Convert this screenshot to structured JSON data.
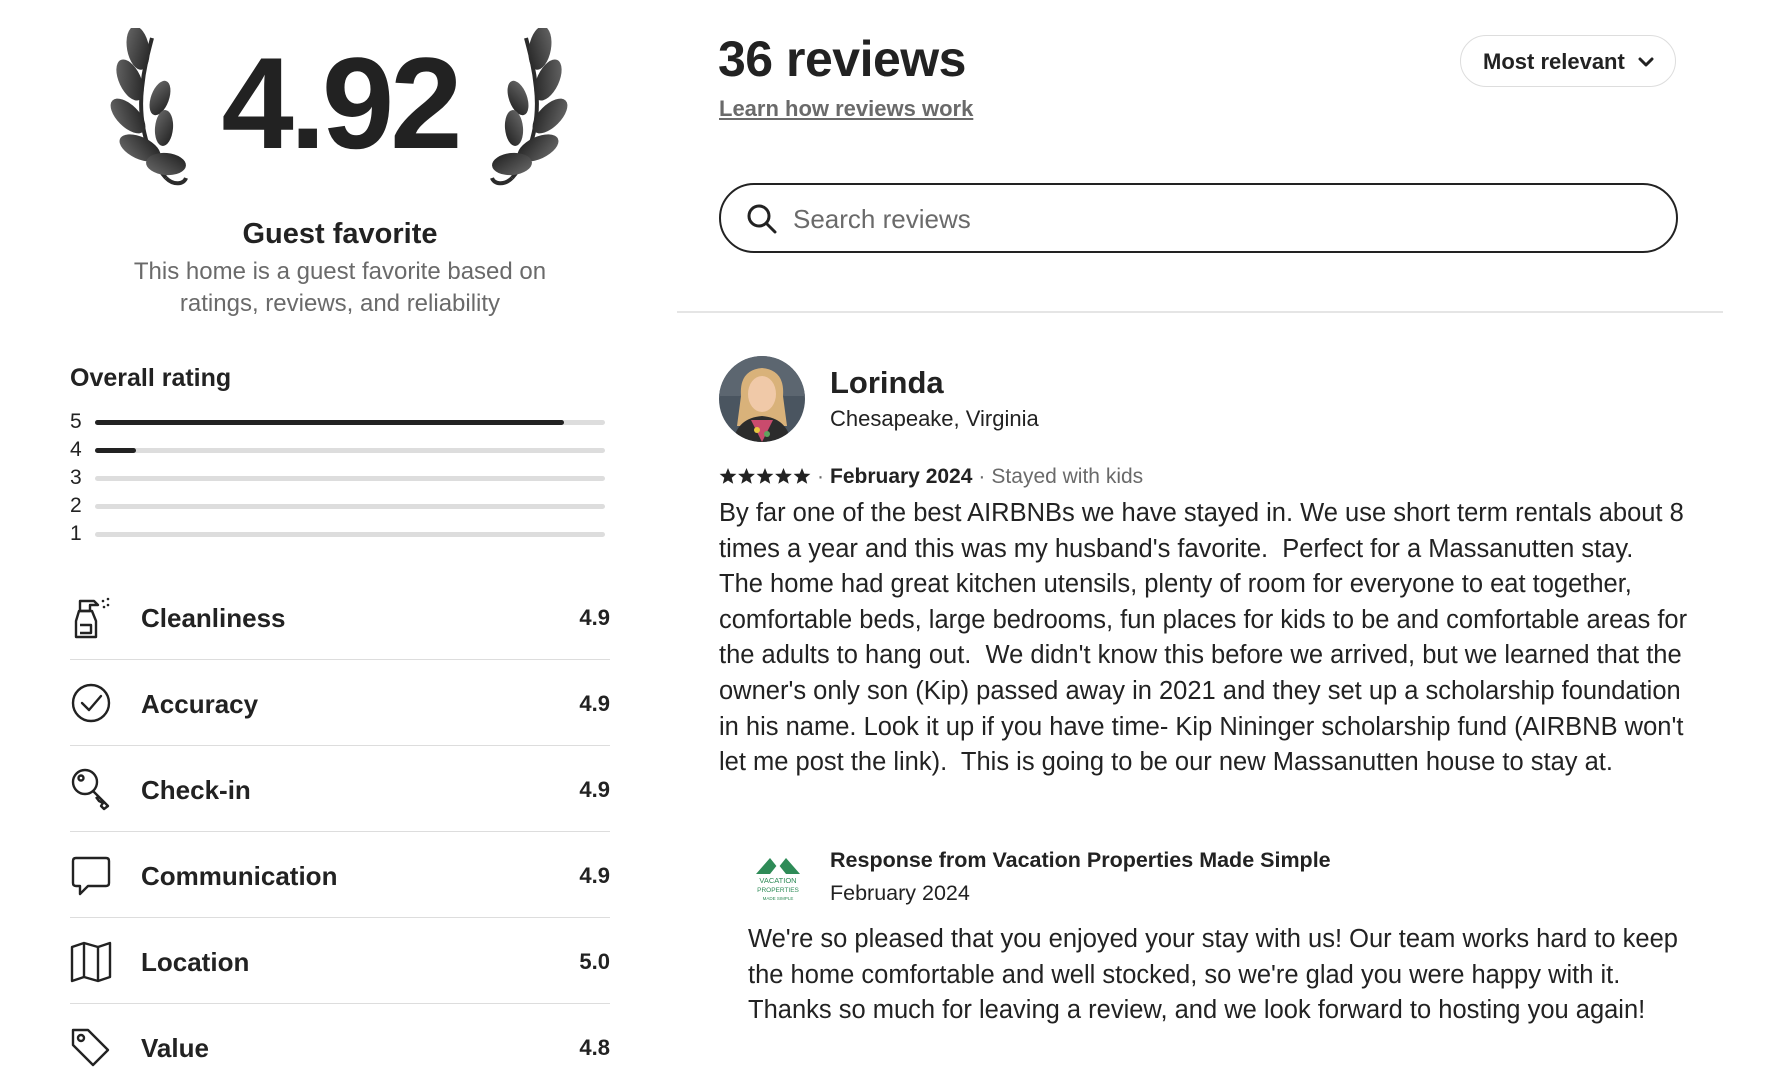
{
  "rating_summary": {
    "score": "4.92",
    "badge_title": "Guest favorite",
    "badge_description": "This home is a guest favorite based on ratings, reviews, and reliability"
  },
  "overall_rating": {
    "label": "Overall rating",
    "distribution": [
      {
        "stars": "5",
        "fraction": 0.92
      },
      {
        "stars": "4",
        "fraction": 0.08
      },
      {
        "stars": "3",
        "fraction": 0.0
      },
      {
        "stars": "2",
        "fraction": 0.0
      },
      {
        "stars": "1",
        "fraction": 0.0
      }
    ]
  },
  "categories": [
    {
      "label": "Cleanliness",
      "value": "4.9",
      "icon": "spray-bottle-icon"
    },
    {
      "label": "Accuracy",
      "value": "4.9",
      "icon": "check-circle-icon"
    },
    {
      "label": "Check-in",
      "value": "4.9",
      "icon": "key-icon"
    },
    {
      "label": "Communication",
      "value": "4.9",
      "icon": "chat-bubble-icon"
    },
    {
      "label": "Location",
      "value": "5.0",
      "icon": "map-icon"
    },
    {
      "label": "Value",
      "value": "4.8",
      "icon": "tag-icon"
    }
  ],
  "reviews_header": {
    "count_label": "36 reviews",
    "learn_link": "Learn how reviews work",
    "sort_label": "Most relevant"
  },
  "search": {
    "placeholder": "Search reviews",
    "value": ""
  },
  "review": {
    "name": "Lorinda",
    "location": "Chesapeake, Virginia",
    "stars": 5,
    "date": "February 2024",
    "stay_type": "Stayed with kids",
    "text": "By far one of the best AIRBNBs we have stayed in. We use short term rentals about 8 times a year and this was my husband's favorite.  Perfect for a Massanutten stay.  The home had great kitchen utensils, plenty of room for everyone to eat together, comfortable beds, large bedrooms, fun places for kids to be and comfortable areas for the adults to hang out.  We didn't know this before we arrived, but we learned that the owner's only son (Kip) passed away in 2021 and they set up a scholarship foundation in his name. Look it up if you have time- Kip Nininger scholarship fund (AIRBNB won't let me post the link).  This is going to be our new Massanutten house to stay at.",
    "response": {
      "title": "Response from Vacation Properties Made Simple",
      "date": "February 2024",
      "logo_text": [
        "VACATION",
        "PROPERTIES",
        "MADE SIMPLE"
      ],
      "text": "We're so pleased that you enjoyed your stay with us! Our team works hard to keep the home comfortable and well stocked, so we're glad you were happy with it. Thanks so much for leaving a review, and we look forward to hosting you again!"
    }
  },
  "colors": {
    "text_primary": "#222222",
    "text_secondary": "#6a6a6a",
    "divider": "#dddddd",
    "host_logo_green": "#2e8b57"
  }
}
